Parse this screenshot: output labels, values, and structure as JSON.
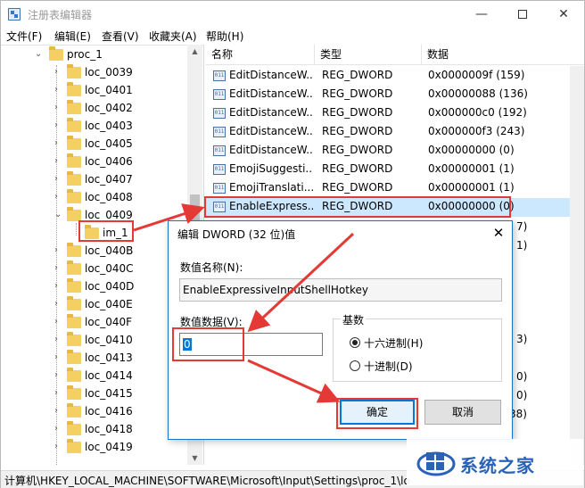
{
  "window": {
    "title": "注册表编辑器"
  },
  "menu": [
    "文件(F)",
    "编辑(E)",
    "查看(V)",
    "收藏夹(A)",
    "帮助(H)"
  ],
  "tree": {
    "parent": "proc_1",
    "items": [
      "loc_0039",
      "loc_0401",
      "loc_0402",
      "loc_0403",
      "loc_0405",
      "loc_0406",
      "loc_0407",
      "loc_0408",
      "loc_0409",
      "im_1",
      "loc_040B",
      "loc_040C",
      "loc_040D",
      "loc_040E",
      "loc_040F",
      "loc_0410",
      "loc_0413",
      "loc_0414",
      "loc_0415",
      "loc_0416",
      "loc_0418",
      "loc_0419"
    ]
  },
  "list": {
    "columns": [
      "名称",
      "类型",
      "数据"
    ],
    "rows": [
      {
        "name": "EditDistanceW...",
        "type": "REG_DWORD",
        "data": "0x0000009f (159)"
      },
      {
        "name": "EditDistanceW...",
        "type": "REG_DWORD",
        "data": "0x00000088 (136)"
      },
      {
        "name": "EditDistanceW...",
        "type": "REG_DWORD",
        "data": "0x000000c0 (192)"
      },
      {
        "name": "EditDistanceW...",
        "type": "REG_DWORD",
        "data": "0x000000f3 (243)"
      },
      {
        "name": "EditDistanceW...",
        "type": "REG_DWORD",
        "data": "0x00000000 (0)"
      },
      {
        "name": "EmojiSuggesti...",
        "type": "REG_DWORD",
        "data": "0x00000001 (1)"
      },
      {
        "name": "EmojiTranslati...",
        "type": "REG_DWORD",
        "data": "0x00000001 (1)"
      },
      {
        "name": "EnableExpress...",
        "type": "REG_DWORD",
        "data": "0x00000000 (0)"
      }
    ],
    "partial_right": [
      "7)",
      "1)",
      "3)",
      "0)",
      "0)",
      "38)"
    ]
  },
  "status": {
    "path": "计算机\\HKEY_LOCAL_MACHINE\\SOFTWARE\\Microsoft\\Input\\Settings\\proc_1\\lo"
  },
  "dialog": {
    "title": "编辑 DWORD (32 位)值",
    "close": "✕",
    "name_label": "数值名称(N):",
    "name_value": "EnableExpressiveInputShellHotkey",
    "data_label": "数值数据(V):",
    "data_value": "0",
    "base_label": "基数",
    "hex_label": "十六进制(H)",
    "dec_label": "十进制(D)",
    "ok": "确定",
    "cancel": "取消"
  },
  "watermark": {
    "text": "系统之家"
  },
  "colors": {
    "annotation": "#e53935",
    "selection": "#cce8ff",
    "accent": "#0078d7"
  }
}
